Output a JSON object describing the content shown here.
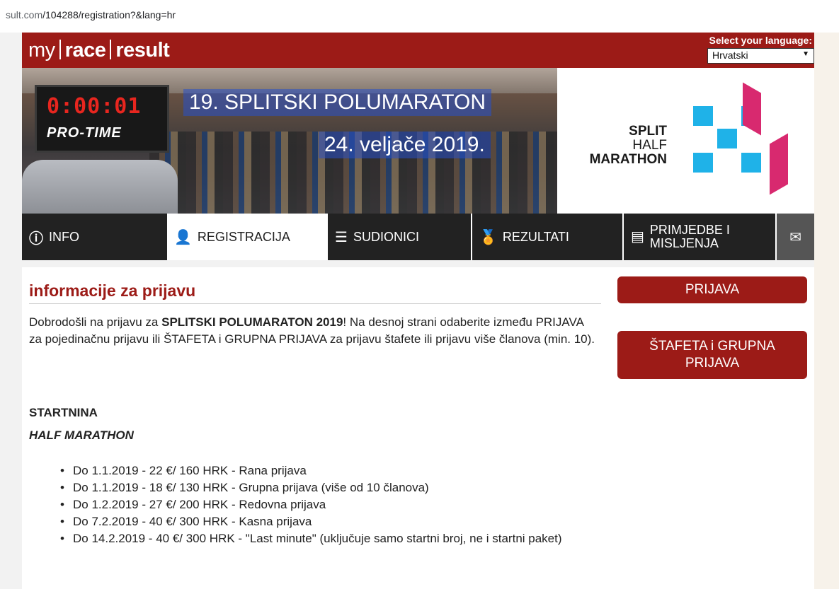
{
  "browser": {
    "url_prefix": "sult.com",
    "url_path": "/104288/registration?&lang=hr"
  },
  "header": {
    "logo": {
      "part1": "my",
      "part2": "race",
      "part3": "result"
    },
    "language_label": "Select your language:",
    "language_selected": "Hrvatski"
  },
  "banner": {
    "timer": "0:00:01",
    "timer_brand": "PRO-TIME",
    "title": "19. SPLITSKI POLUMARATON",
    "date": "24. veljače 2019.",
    "logo_text": [
      "SPLIT",
      "HALF",
      "MARATHON"
    ]
  },
  "nav": {
    "items": [
      {
        "label": "INFO",
        "icon": "info-icon"
      },
      {
        "label": "REGISTRACIJA",
        "icon": "user-add-icon"
      },
      {
        "label": "SUDIONICI",
        "icon": "list-icon"
      },
      {
        "label": "REZULTATI",
        "icon": "medal-icon"
      },
      {
        "label": "PRIMJEDBE I",
        "label2": "MISLJENJA",
        "icon": "comment-icon"
      }
    ],
    "mail_icon": "envelope-icon"
  },
  "main": {
    "heading": "informacije za prijavu",
    "intro_pre": "Dobrodošli na prijavu za ",
    "intro_bold": "SPLITSKI POLUMARATON 2019",
    "intro_post": "! Na desnoj strani odaberite između PRIJAVA za pojedinačnu prijavu ili ŠTAFETA i GRUPNA PRIJAVA za prijavu štafete ili prijavu više članova (min. 10).",
    "fee_heading": "STARTNINA",
    "fee_subheading": "HALF MARATHON",
    "fees": [
      "Do 1.1.2019 - 22 €/ 160 HRK - Rana prijava",
      "Do 1.1.2019 - 18 €/ 130 HRK - Grupna prijava (više od 10 članova)",
      "Do 1.2.2019 - 27 €/ 200 HRK - Redovna prijava",
      "Do 7.2.2019 - 40 €/ 300 HRK - Kasna prijava",
      "Do 14.2.2019 - 40 €/ 300 HRK - \"Last minute\" (uključuje samo startni broj, ne i startni paket)"
    ]
  },
  "sidebar": {
    "btn_prijava": "PRIJAVA",
    "btn_stafeta": "ŠTAFETA i GRUPNA PRIJAVA"
  },
  "colors": {
    "brand_red": "#9c1b17",
    "nav_dark": "#222222",
    "logo_blue": "#1fb2e8",
    "logo_magenta": "#d8296f"
  }
}
